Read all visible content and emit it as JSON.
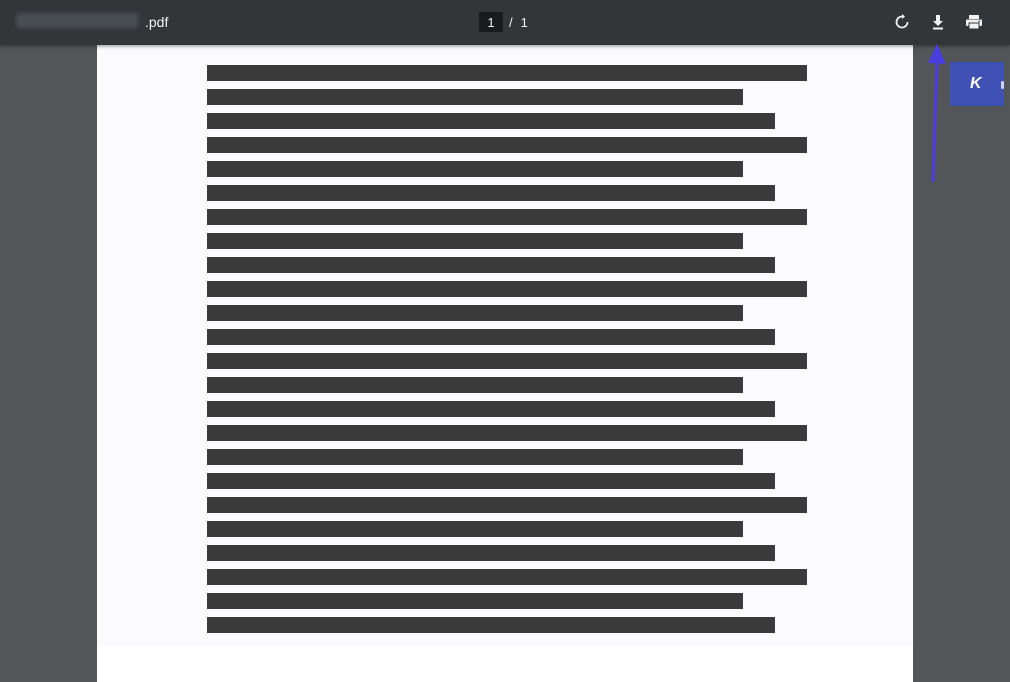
{
  "toolbar": {
    "file_extension": ".pdf",
    "current_page": "1",
    "page_separator": "/",
    "total_pages": "1",
    "icons": {
      "rotate": "rotate-icon",
      "download": "download-icon",
      "print": "print-icon"
    }
  },
  "document": {
    "text_lines_redacted": 24
  },
  "extension_badge": {
    "label": "K",
    "color": "#3f51b5"
  },
  "annotation": {
    "arrow_color": "#4a3de0"
  }
}
